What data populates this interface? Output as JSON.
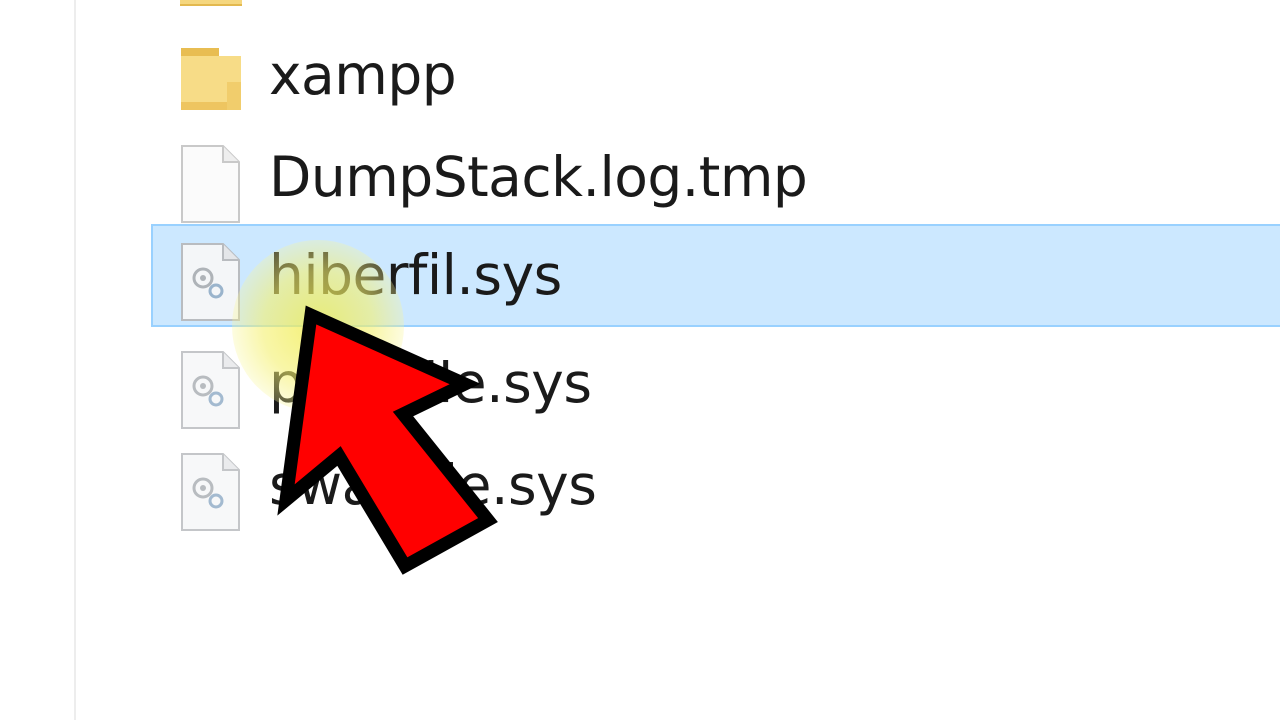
{
  "files": [
    {
      "name": "xampp",
      "type": "folder",
      "icon": "folder-icon",
      "selected": false
    },
    {
      "name": "DumpStack.log.tmp",
      "type": "file",
      "icon": "file-icon",
      "selected": false
    },
    {
      "name": "hiberfil.sys",
      "type": "system-file",
      "icon": "system-file-icon",
      "selected": true
    },
    {
      "name": "pagefile.sys",
      "type": "system-file",
      "icon": "system-file-icon",
      "selected": false
    },
    {
      "name": "swapfile.sys",
      "type": "system-file",
      "icon": "system-file-icon",
      "selected": false
    }
  ],
  "colors": {
    "selection_background": "#cce8ff",
    "selection_border": "#99d1ff",
    "folder_yellow": "#f5d77f",
    "annotation_arrow": "#ff0000",
    "cursor_highlight": "#f0ec50"
  }
}
